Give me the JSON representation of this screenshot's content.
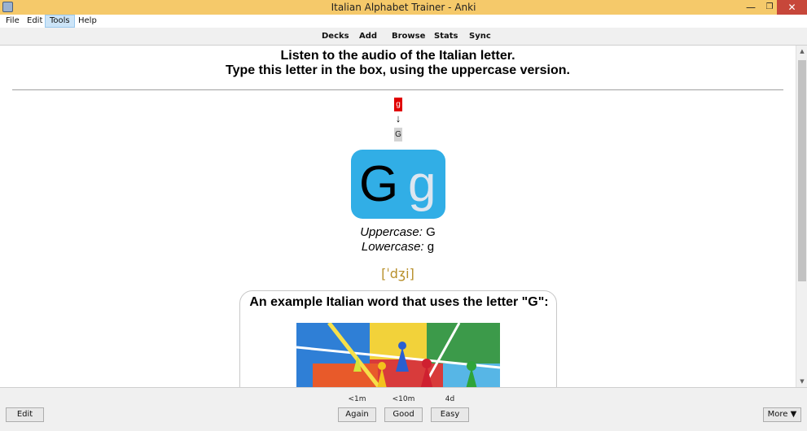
{
  "window": {
    "title": "Italian Alphabet Trainer - Anki",
    "minimize": "—",
    "maximize": "❐",
    "close": "✕"
  },
  "menu": {
    "items": [
      {
        "label": "File"
      },
      {
        "label": "Edit"
      },
      {
        "label": "Tools"
      },
      {
        "label": "Help"
      }
    ]
  },
  "toolbar": {
    "links": [
      {
        "label": "Decks"
      },
      {
        "label": "Add"
      },
      {
        "label": "Browse"
      },
      {
        "label": "Stats"
      },
      {
        "label": "Sync"
      }
    ]
  },
  "card": {
    "instruction_line1": "Listen to the audio of the Italian letter.",
    "instruction_line2": "Type this letter in the box, using the uppercase version.",
    "typed_answer": "g",
    "arrow": "↓",
    "correct_answer": "G",
    "big_upper": "G",
    "big_lower": "g",
    "uppercase_label": "Uppercase:",
    "uppercase_value": "G",
    "lowercase_label": "Lowercase:",
    "lowercase_value": "g",
    "ipa": "[ˈdʒi]",
    "example_title": "An example Italian word that uses the letter \"G\":"
  },
  "scrollbar": {
    "up": "▲",
    "down": "▼"
  },
  "answer_bar": {
    "edit_label": "Edit",
    "more_label": "More ▼",
    "buttons": [
      {
        "interval": "<1m",
        "label": "Again"
      },
      {
        "interval": "<10m",
        "label": "Good"
      },
      {
        "interval": "4d",
        "label": "Easy"
      }
    ]
  }
}
